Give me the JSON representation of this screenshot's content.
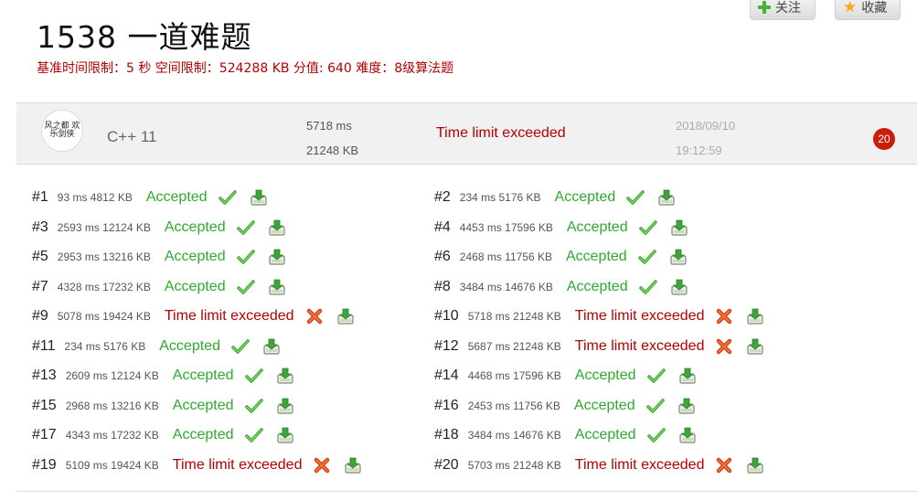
{
  "problem": {
    "title": "1538 一道难题",
    "limits": "基准时间限制：5 秒 空间限制：524288 KB 分值: 640 难度：8级算法题"
  },
  "actions": {
    "follow_label": "关注",
    "favorite_label": "收藏"
  },
  "submission": {
    "avatar_text": "风之都 欢乐剑侠",
    "language": "C++ 11",
    "time": "5718 ms",
    "memory": "21248 KB",
    "status": "Time limit exceeded",
    "date": "2018/09/10",
    "clock": "19:12:59",
    "score": "20"
  },
  "colors": {
    "accepted": "#2eaa2e",
    "tle": "#b30000",
    "score_badge": "#cc1c0a"
  },
  "icons": {
    "accepted": "green-check-icon",
    "tle": "red-cross-icon",
    "download": "download-icon"
  },
  "tests": [
    {
      "num": "#1",
      "stats": "93 ms 4812 KB",
      "status": "Accepted",
      "ok": true
    },
    {
      "num": "#2",
      "stats": "234 ms 5176 KB",
      "status": "Accepted",
      "ok": true
    },
    {
      "num": "#3",
      "stats": "2593 ms 12124 KB",
      "status": "Accepted",
      "ok": true
    },
    {
      "num": "#4",
      "stats": "4453 ms 17596 KB",
      "status": "Accepted",
      "ok": true
    },
    {
      "num": "#5",
      "stats": "2953 ms 13216 KB",
      "status": "Accepted",
      "ok": true
    },
    {
      "num": "#6",
      "stats": "2468 ms 11756 KB",
      "status": "Accepted",
      "ok": true
    },
    {
      "num": "#7",
      "stats": "4328 ms 17232 KB",
      "status": "Accepted",
      "ok": true
    },
    {
      "num": "#8",
      "stats": "3484 ms 14676 KB",
      "status": "Accepted",
      "ok": true
    },
    {
      "num": "#9",
      "stats": "5078 ms 19424 KB",
      "status": "Time limit exceeded",
      "ok": false
    },
    {
      "num": "#10",
      "stats": "5718 ms 21248 KB",
      "status": "Time limit exceeded",
      "ok": false
    },
    {
      "num": "#11",
      "stats": "234 ms 5176 KB",
      "status": "Accepted",
      "ok": true
    },
    {
      "num": "#12",
      "stats": "5687 ms 21248 KB",
      "status": "Time limit exceeded",
      "ok": false
    },
    {
      "num": "#13",
      "stats": "2609 ms 12124 KB",
      "status": "Accepted",
      "ok": true
    },
    {
      "num": "#14",
      "stats": "4468 ms 17596 KB",
      "status": "Accepted",
      "ok": true
    },
    {
      "num": "#15",
      "stats": "2968 ms 13216 KB",
      "status": "Accepted",
      "ok": true
    },
    {
      "num": "#16",
      "stats": "2453 ms 11756 KB",
      "status": "Accepted",
      "ok": true
    },
    {
      "num": "#17",
      "stats": "4343 ms 17232 KB",
      "status": "Accepted",
      "ok": true
    },
    {
      "num": "#18",
      "stats": "3484 ms 14676 KB",
      "status": "Accepted",
      "ok": true
    },
    {
      "num": "#19",
      "stats": "5109 ms 19424 KB",
      "status": "Time limit exceeded",
      "ok": false
    },
    {
      "num": "#20",
      "stats": "5703 ms 21248 KB",
      "status": "Time limit exceeded",
      "ok": false
    }
  ]
}
